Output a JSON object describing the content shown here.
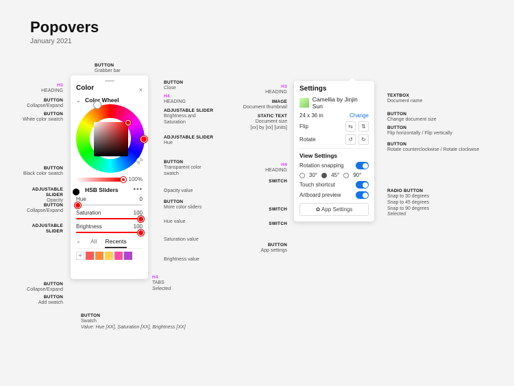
{
  "page": {
    "title": "Popovers",
    "date": "January 2021"
  },
  "colorPanel": {
    "heading": "Color",
    "sections": {
      "wheel": {
        "label": "Color Wheel"
      },
      "opacity": {
        "value": "100%"
      },
      "hsb": {
        "label": "HSB Sliders",
        "sliders": {
          "hue": {
            "label": "Hue",
            "value": "0"
          },
          "sat": {
            "label": "Saturation",
            "value": "100"
          },
          "bri": {
            "label": "Brightness",
            "value": "100"
          }
        }
      }
    },
    "tabs": {
      "all": "All",
      "recents": "Recents"
    },
    "swatches": [
      "#f45b5b",
      "#ff8b3d",
      "#ffd24d",
      "#ff4fa3",
      "#b343cc"
    ]
  },
  "settingsPanel": {
    "heading": "Settings",
    "docName": "Camellia by Jinjin Sun",
    "docSize": "24 x 36 in",
    "change": "Change",
    "flip": {
      "label": "Flip"
    },
    "rotate": {
      "label": "Rotate"
    },
    "viewHeading": "View Settings",
    "rows": {
      "snap": "Rotation snapping",
      "touch": "Touch shortcut",
      "artboard": "Artboard preview"
    },
    "radios": {
      "a": "30°",
      "b": "45°",
      "c": "90°"
    },
    "appSettings": "✿  App Settings"
  },
  "ann": {
    "l": {
      "h3": {
        "k": "H3",
        "t": "HEADING"
      },
      "collapse1": {
        "k": "BUTTON",
        "t": "Collapse/Expand"
      },
      "white": {
        "k": "BUTTON",
        "t": "White color swatch"
      },
      "black": {
        "k": "BUTTON",
        "t": "Black color swatch"
      },
      "opacity": {
        "k": "ADJUSTABLE SLIDER",
        "t": "Opacity"
      },
      "collapse2": {
        "k": "BUTTON",
        "t": "Collapse/Expand"
      },
      "adjSlider": {
        "k": "ADJUSTABLE SLIDER",
        "t": ""
      },
      "collapse3": {
        "k": "BUTTON",
        "t": "Collapse/Expand"
      },
      "addSwatch": {
        "k": "BUTTON",
        "t": "Add swatch"
      }
    },
    "r": {
      "grabber": {
        "k": "BUTTON",
        "t": "Grabber bar"
      },
      "close": {
        "k": "BUTTON",
        "t": "Close"
      },
      "h4a": {
        "k": "H4",
        "t": "HEADING"
      },
      "brSat": {
        "k": "ADJUSTABLE SLIDER",
        "t": "Brightness and Saturation"
      },
      "hue": {
        "k": "ADJUSTABLE SLIDER",
        "t": "Hue"
      },
      "trans": {
        "k": "BUTTON",
        "t": "Transparent color swatch"
      },
      "opVal": {
        "k": "",
        "t": "Opacity value"
      },
      "more": {
        "k": "BUTTON",
        "t": "More color sliders"
      },
      "hueVal": {
        "k": "",
        "t": "Hue value"
      },
      "satVal": {
        "k": "",
        "t": "Saturation value"
      },
      "briVal": {
        "k": "",
        "t": "Brightness value"
      },
      "h4b": {
        "k": "H4",
        "t": "TABS"
      },
      "h4bSel": {
        "k": "",
        "t": "Selected"
      },
      "swatchB": {
        "k": "BUTTON",
        "t": "Swatch"
      },
      "swatchV": {
        "k": "",
        "t": "Value: Hue [XX], Saturation [XX], Brightness [XX]"
      }
    },
    "sL": {
      "h3": {
        "k": "H3",
        "t": "HEADING"
      },
      "img": {
        "k": "IMAGE",
        "t": "Document thumbnail"
      },
      "size": {
        "k": "STATIC TEXT",
        "t": "Document size\n[xx] by [xx] [units]"
      },
      "h4": {
        "k": "H4",
        "t": "HEADING"
      },
      "sw1": {
        "k": "SWITCH",
        "t": ""
      },
      "sw2": {
        "k": "SWITCH",
        "t": ""
      },
      "sw3": {
        "k": "SWITCH",
        "t": ""
      },
      "app": {
        "k": "BUTTON",
        "t": "App settings"
      }
    },
    "sR": {
      "tb": {
        "k": "TEXTBOX",
        "t": "Document name"
      },
      "chg": {
        "k": "BUTTON",
        "t": "Change document size"
      },
      "flip": {
        "k": "BUTTON",
        "t": "Flip horizontally / Flip vertically"
      },
      "rot": {
        "k": "BUTTON",
        "t": "Rotate counterclockwise / Rotate clockwise"
      },
      "rad": {
        "k": "RADIO BUTTON",
        "t": "Snap to 30 degrees\nSnap to 45 degrees\nSnap to 90 degrees"
      },
      "radSel": {
        "k": "",
        "t": "Selected"
      }
    }
  }
}
